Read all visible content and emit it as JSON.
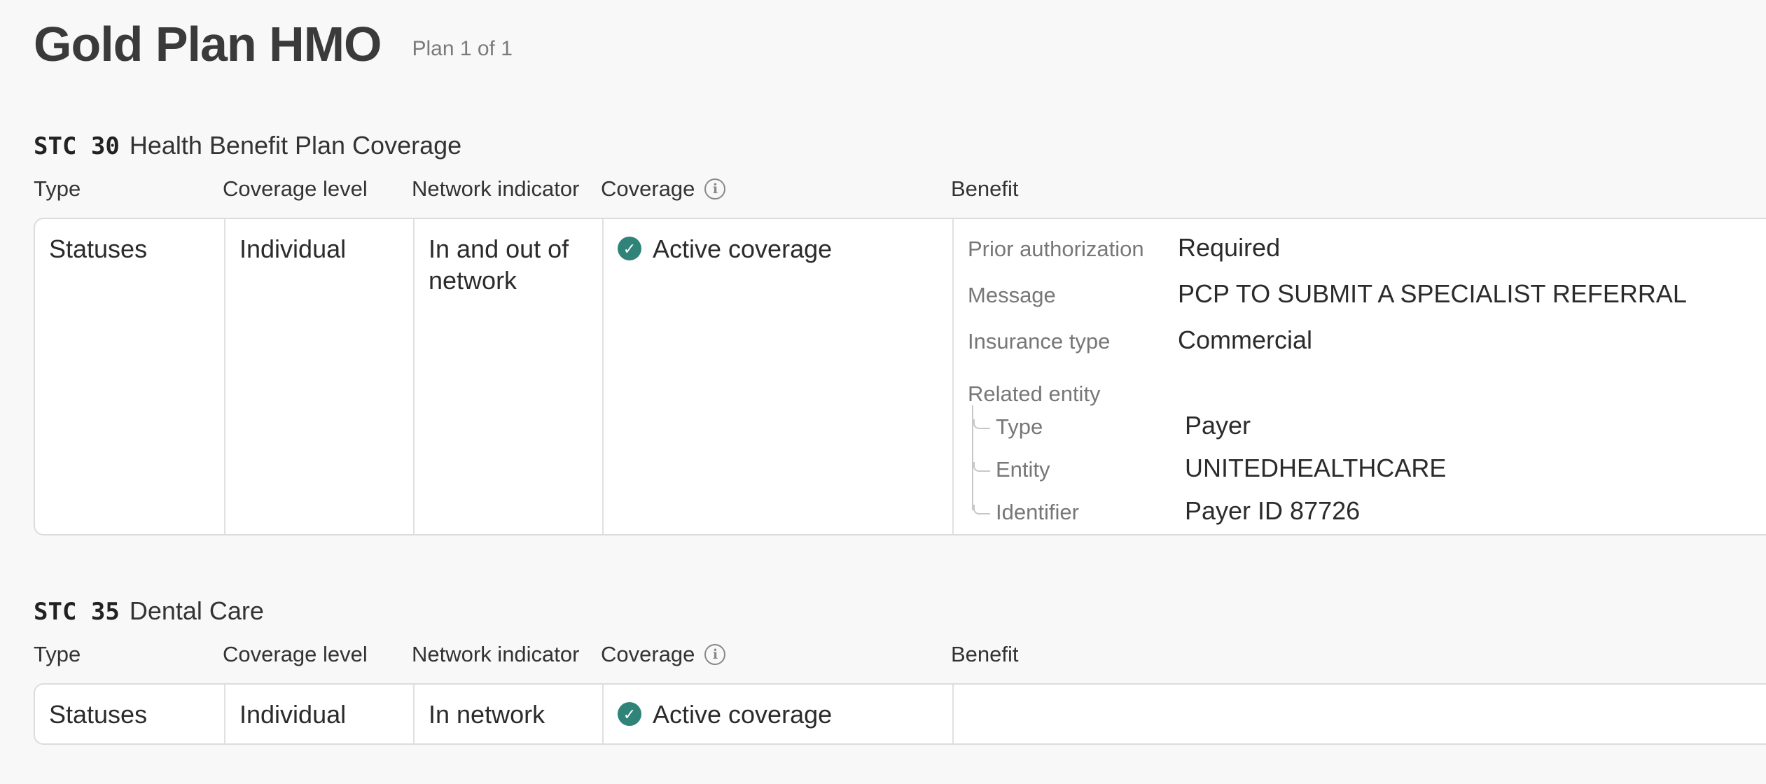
{
  "header": {
    "plan_title": "Gold Plan HMO",
    "plan_count": "Plan 1 of 1"
  },
  "columns": {
    "type": "Type",
    "coverage_level": "Coverage level",
    "network_indicator": "Network indicator",
    "coverage": "Coverage",
    "benefit": "Benefit"
  },
  "icons": {
    "info": "info-icon",
    "status": "check-circle-icon"
  },
  "colors": {
    "status_active": "#2f8378"
  },
  "sections": [
    {
      "stc_code": "STC 30",
      "name": "Health Benefit Plan Coverage",
      "row": {
        "type": "Statuses",
        "coverage_level": "Individual",
        "network_indicator": "In and out of network",
        "coverage": "Active coverage",
        "benefit": {
          "prior_authorization_label": "Prior authorization",
          "prior_authorization": "Required",
          "message_label": "Message",
          "message": "PCP TO SUBMIT A SPECIALIST REFERRAL",
          "insurance_type_label": "Insurance type",
          "insurance_type": "Commercial",
          "related_entity_label": "Related entity",
          "related_entity": {
            "type_label": "Type",
            "type": "Payer",
            "entity_label": "Entity",
            "entity": "UNITEDHEALTHCARE",
            "identifier_label": "Identifier",
            "identifier": "Payer ID 87726"
          }
        }
      }
    },
    {
      "stc_code": "STC 35",
      "name": "Dental Care",
      "row": {
        "type": "Statuses",
        "coverage_level": "Individual",
        "network_indicator": "In network",
        "coverage": "Active coverage"
      }
    }
  ]
}
